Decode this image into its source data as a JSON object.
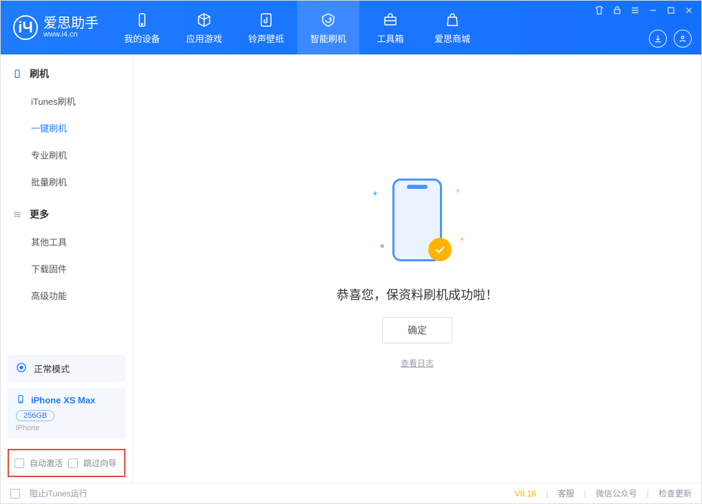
{
  "app": {
    "name": "爱思助手",
    "site": "www.i4.cn"
  },
  "nav": {
    "tabs": [
      {
        "label": "我的设备",
        "icon": "device-icon"
      },
      {
        "label": "应用游戏",
        "icon": "cube-icon"
      },
      {
        "label": "铃声壁纸",
        "icon": "music-icon"
      },
      {
        "label": "智能刷机",
        "icon": "refresh-icon"
      },
      {
        "label": "工具箱",
        "icon": "toolbox-icon"
      },
      {
        "label": "爱思商城",
        "icon": "bag-icon"
      }
    ],
    "active_index": 3
  },
  "sidebar": {
    "sections": [
      {
        "title": "刷机",
        "icon": "phone-icon",
        "items": [
          {
            "label": "iTunes刷机"
          },
          {
            "label": "一键刷机"
          },
          {
            "label": "专业刷机"
          },
          {
            "label": "批量刷机"
          }
        ],
        "active_index": 1
      },
      {
        "title": "更多",
        "icon": "menu-icon",
        "items": [
          {
            "label": "其他工具"
          },
          {
            "label": "下载固件"
          },
          {
            "label": "高级功能"
          }
        ],
        "active_index": -1
      }
    ],
    "mode_label": "正常模式",
    "device": {
      "name": "iPhone XS Max",
      "capacity": "256GB",
      "model": "iPhone"
    },
    "options": {
      "auto_activate": "自动激活",
      "skip_guide": "跳过向导"
    }
  },
  "main": {
    "success_text": "恭喜您，保资料刷机成功啦！",
    "ok_label": "确定",
    "view_log": "查看日志"
  },
  "footer": {
    "block_itunes": "阻止iTunes运行",
    "version": "V8.16",
    "links": [
      "客服",
      "微信公众号",
      "检查更新"
    ]
  }
}
